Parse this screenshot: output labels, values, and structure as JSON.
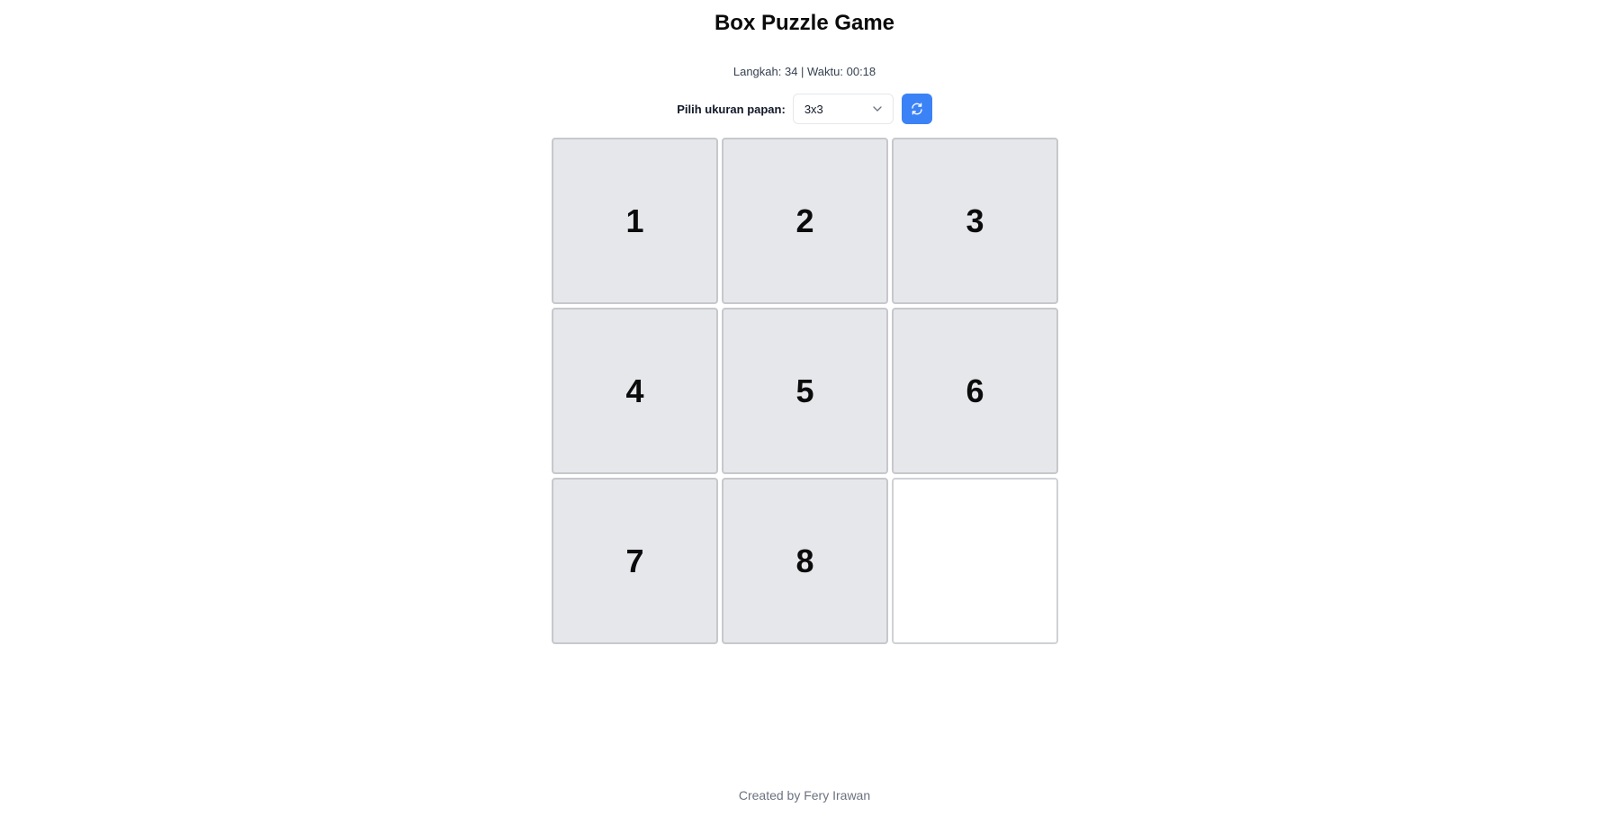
{
  "title": "Box Puzzle Game",
  "status": {
    "text": "Langkah: 34 | Waktu: 00:18",
    "moves": 34,
    "time": "00:18"
  },
  "controls": {
    "board_size_label": "Pilih ukuran papan:",
    "board_size_selected": "3x3",
    "refresh_icon": "refresh-icon",
    "accent_color": "#3b82f6"
  },
  "board": {
    "size": 3,
    "tiles": [
      "1",
      "2",
      "3",
      "4",
      "5",
      "6",
      "7",
      "8",
      ""
    ]
  },
  "footer": {
    "credit": "Created by Fery Irawan"
  }
}
